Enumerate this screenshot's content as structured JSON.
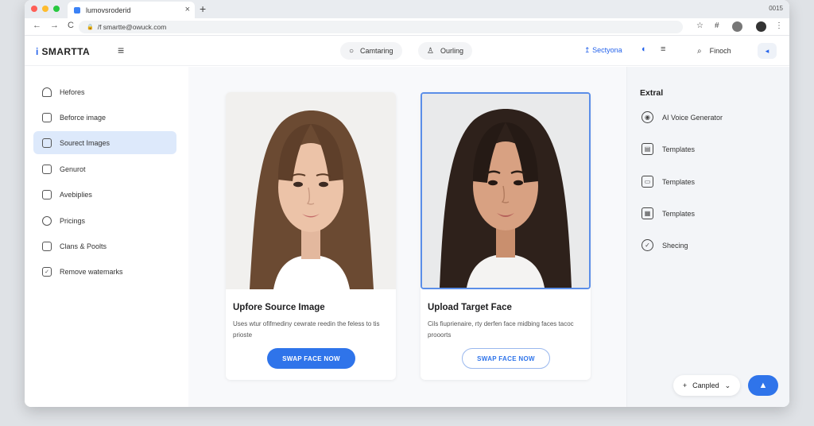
{
  "browser": {
    "tab_title": "lumovsroderid",
    "tab_close": "×",
    "new_tab": "+",
    "top_right_label": "0015",
    "url": "/f smartte@owuck.com",
    "back": "←",
    "forward": "→",
    "reload": "C",
    "lock": "🔒",
    "star": "☆",
    "ext": "#",
    "menu": "⋮"
  },
  "header": {
    "brand": "SMARTTA",
    "brand_mark": "i",
    "menu_icon": "≡",
    "pills": [
      {
        "icon": "○",
        "label": "Camtaring"
      },
      {
        "icon": "♙",
        "label": "Ourling"
      }
    ],
    "link_icon": "↥",
    "link_label": "Sectyona",
    "search_label": "Finoch",
    "search_icon": "⌕",
    "send_icon": "◂"
  },
  "sidebar": {
    "items": [
      {
        "label": "Hefores",
        "icon": "♙"
      },
      {
        "label": "Beforce image",
        "icon": "▢"
      },
      {
        "label": "Sourect Images",
        "icon": "▢"
      },
      {
        "label": "Genurot",
        "icon": "▢"
      },
      {
        "label": "Avebiplies",
        "icon": "▢"
      },
      {
        "label": "Pricings",
        "icon": "▢"
      },
      {
        "label": "Clans & Poolts",
        "icon": "▢"
      },
      {
        "label": "Remove watemarks",
        "icon": "✓"
      }
    ],
    "active_index": 2,
    "active_color": "#dde9fb"
  },
  "main": {
    "cards": [
      {
        "title": "Upfore Source Image",
        "desc": "Uses wtur ofifmediny cewrate reedin the feless to tis prioste",
        "button": "SWAP FACE NOW",
        "button_style": "filled"
      },
      {
        "title": "Upload Target Face",
        "desc": "Cils fiuprienaire, rty derfen face midbing faces tacoc prooorts",
        "button": "SWAP FACE NOW",
        "button_style": "outline"
      }
    ]
  },
  "right_panel": {
    "title": "Extral",
    "items": [
      {
        "label": "AI Voice Generator",
        "icon": "◉"
      },
      {
        "label": "Templates",
        "icon": "▤"
      },
      {
        "label": "Templates",
        "icon": "▭"
      },
      {
        "label": "Templates",
        "icon": "▦"
      },
      {
        "label": "Shecing",
        "icon": "✓"
      }
    ],
    "cancel_label": "Canpled",
    "cancel_plus": "+",
    "cancel_chevron": "⌄",
    "fab_icon": "▲"
  },
  "colors": {
    "accent": "#2f74ea",
    "active_bg": "#dde9fb"
  }
}
